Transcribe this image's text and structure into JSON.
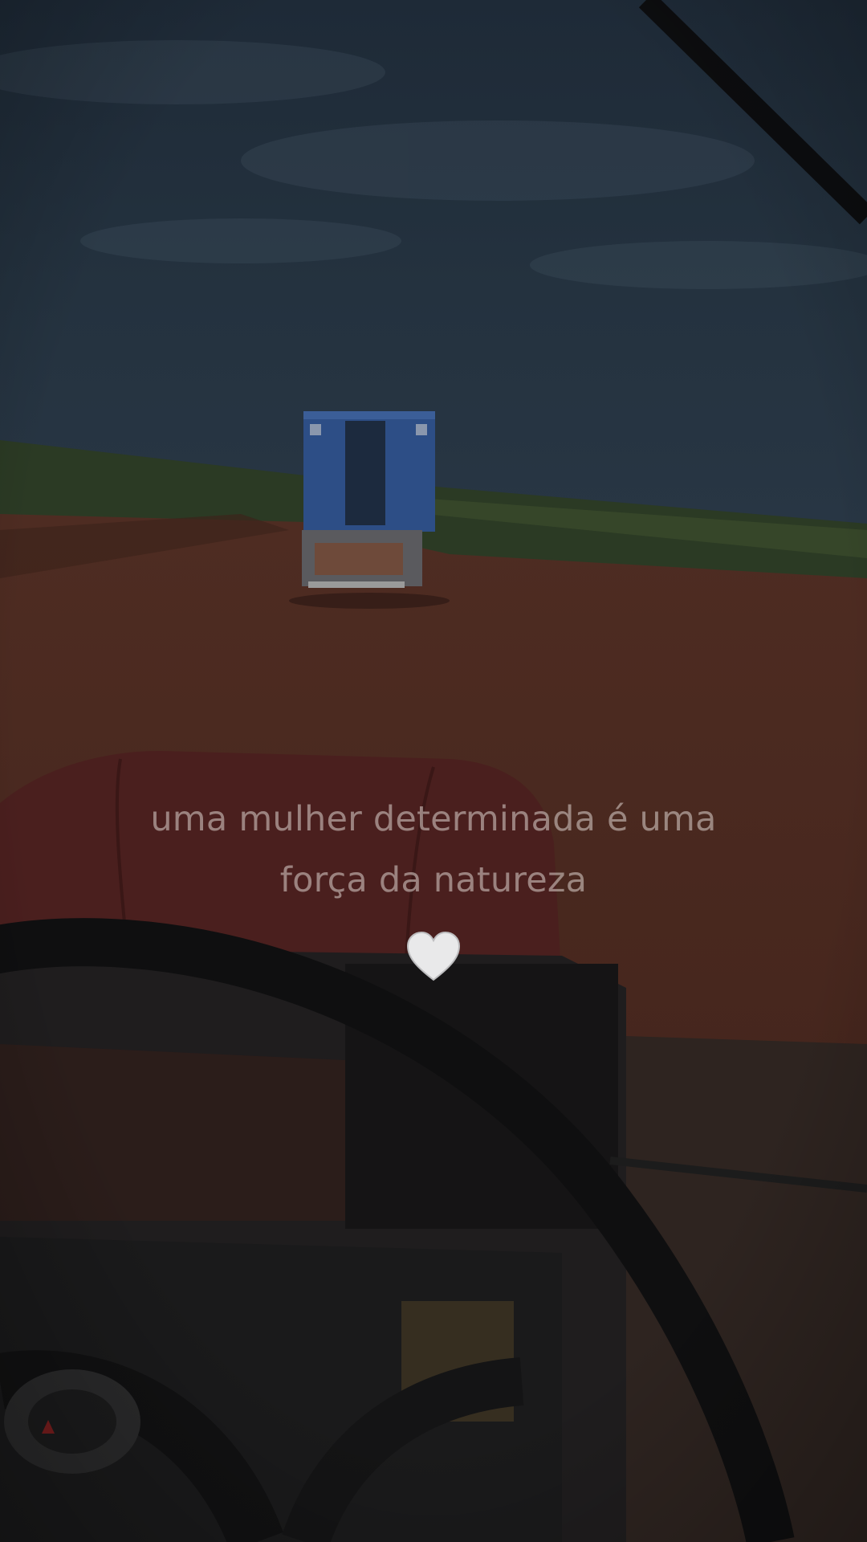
{
  "caption": {
    "line1": "uma mulher determinada é uma",
    "line2": "força da natureza"
  },
  "emoji": {
    "icon": "white-heart-icon",
    "color": "#e9e9ea"
  },
  "colors": {
    "sky": "#1f2c3b",
    "field": "#2c3c26",
    "dirt_road": "#4a2a22",
    "tractor_hood": "#4a1f1e",
    "truck_body": "#2d4e86"
  }
}
